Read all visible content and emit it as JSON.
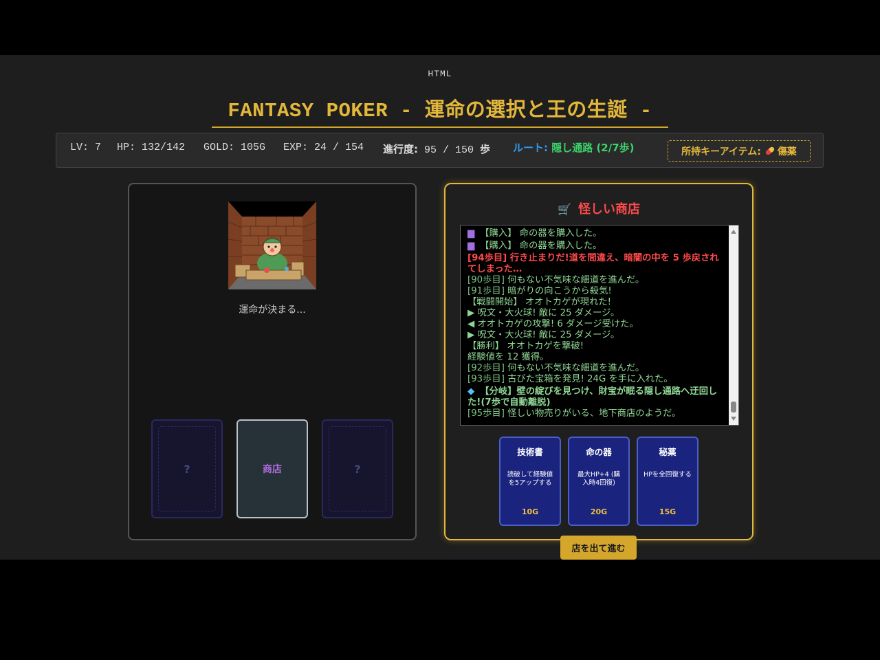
{
  "header": {
    "html_label": "HTML",
    "title": "FANTASY POKER - 運命の選択と王の生誕 -"
  },
  "status": {
    "lv": "LV: 7",
    "hp": "HP: 132/142",
    "gold": "GOLD: 105G",
    "exp": "EXP: 24 / 154",
    "progress_label": "進行度:",
    "progress_value": "95 / 150",
    "progress_unit": "歩",
    "route_label": "ルート:",
    "route_value": "隠し通路 (2/7歩)",
    "key_item_label": "所持キーアイテム:",
    "key_item_name": "傷薬",
    "key_item_icon": "pill-icon"
  },
  "scene": {
    "caption": "運命が決まる...",
    "cards": [
      {
        "label": "?",
        "state": "hidden"
      },
      {
        "label": "商店",
        "state": "revealed"
      },
      {
        "label": "?",
        "state": "hidden"
      }
    ]
  },
  "shop": {
    "title": "怪しい商店",
    "title_icon": "cart-icon",
    "log": [
      {
        "icon": "box-icon",
        "text": "【購入】 命の器を購入した。",
        "kind": "purchase"
      },
      {
        "icon": "box-icon",
        "text": "【購入】 命の器を購入した。",
        "kind": "purchase"
      },
      {
        "text": "[94歩目] 行き止まりだ!道を間違え、暗闇の中を 5 歩戻されてしまった…",
        "kind": "red"
      },
      {
        "step": "[90歩目]",
        "text": " 何もない不気味な細道を進んだ。",
        "kind": "normal"
      },
      {
        "step": "[91歩目]",
        "text": " 暗がりの向こうから殺気!",
        "kind": "normal"
      },
      {
        "text": "【戦闘開始】 オオトカゲが現れた!",
        "kind": "normal"
      },
      {
        "text": "▶ 呪文・大火球! 敵に 25 ダメージ。",
        "kind": "normal"
      },
      {
        "text": "◀ オオトカゲの攻撃! 6 ダメージ受けた。",
        "kind": "normal"
      },
      {
        "text": "▶ 呪文・大火球! 敵に 25 ダメージ。",
        "kind": "normal"
      },
      {
        "text": "【勝利】 オオトカゲを撃破!",
        "kind": "normal"
      },
      {
        "text": "経験値を 12 獲得。",
        "kind": "normal"
      },
      {
        "step": "[92歩目]",
        "text": " 何もない不気味な細道を進んだ。",
        "kind": "normal"
      },
      {
        "step": "[93歩目]",
        "text": " 古びた宝箱を発見! 24G を手に入れた。",
        "kind": "normal"
      },
      {
        "icon": "gem-icon",
        "text": "【分岐】壁の綻びを見つけ、財宝が眠る隠し通路へ迂回した!(7歩で自動離脱)",
        "kind": "branch"
      },
      {
        "step": "[95歩目]",
        "text": " 怪しい物売りがいる、地下商店のようだ。",
        "kind": "normal"
      }
    ],
    "items": [
      {
        "name": "技術書",
        "desc": "読破して経験値を5アップする",
        "price": "10G"
      },
      {
        "name": "命の器",
        "desc": "最大HP+4 (購入時4回復)",
        "price": "20G"
      },
      {
        "name": "秘薬",
        "desc": "HPを全回復する",
        "price": "15G"
      }
    ],
    "leave_button": "店を出て進む"
  },
  "colors": {
    "gold": "#e2b73a",
    "route_blue": "#2e9bf2",
    "route_green": "#3cd26a",
    "shop_red": "#ff4a4a",
    "log_green": "#8fd694",
    "item_bg": "#1a237e"
  }
}
